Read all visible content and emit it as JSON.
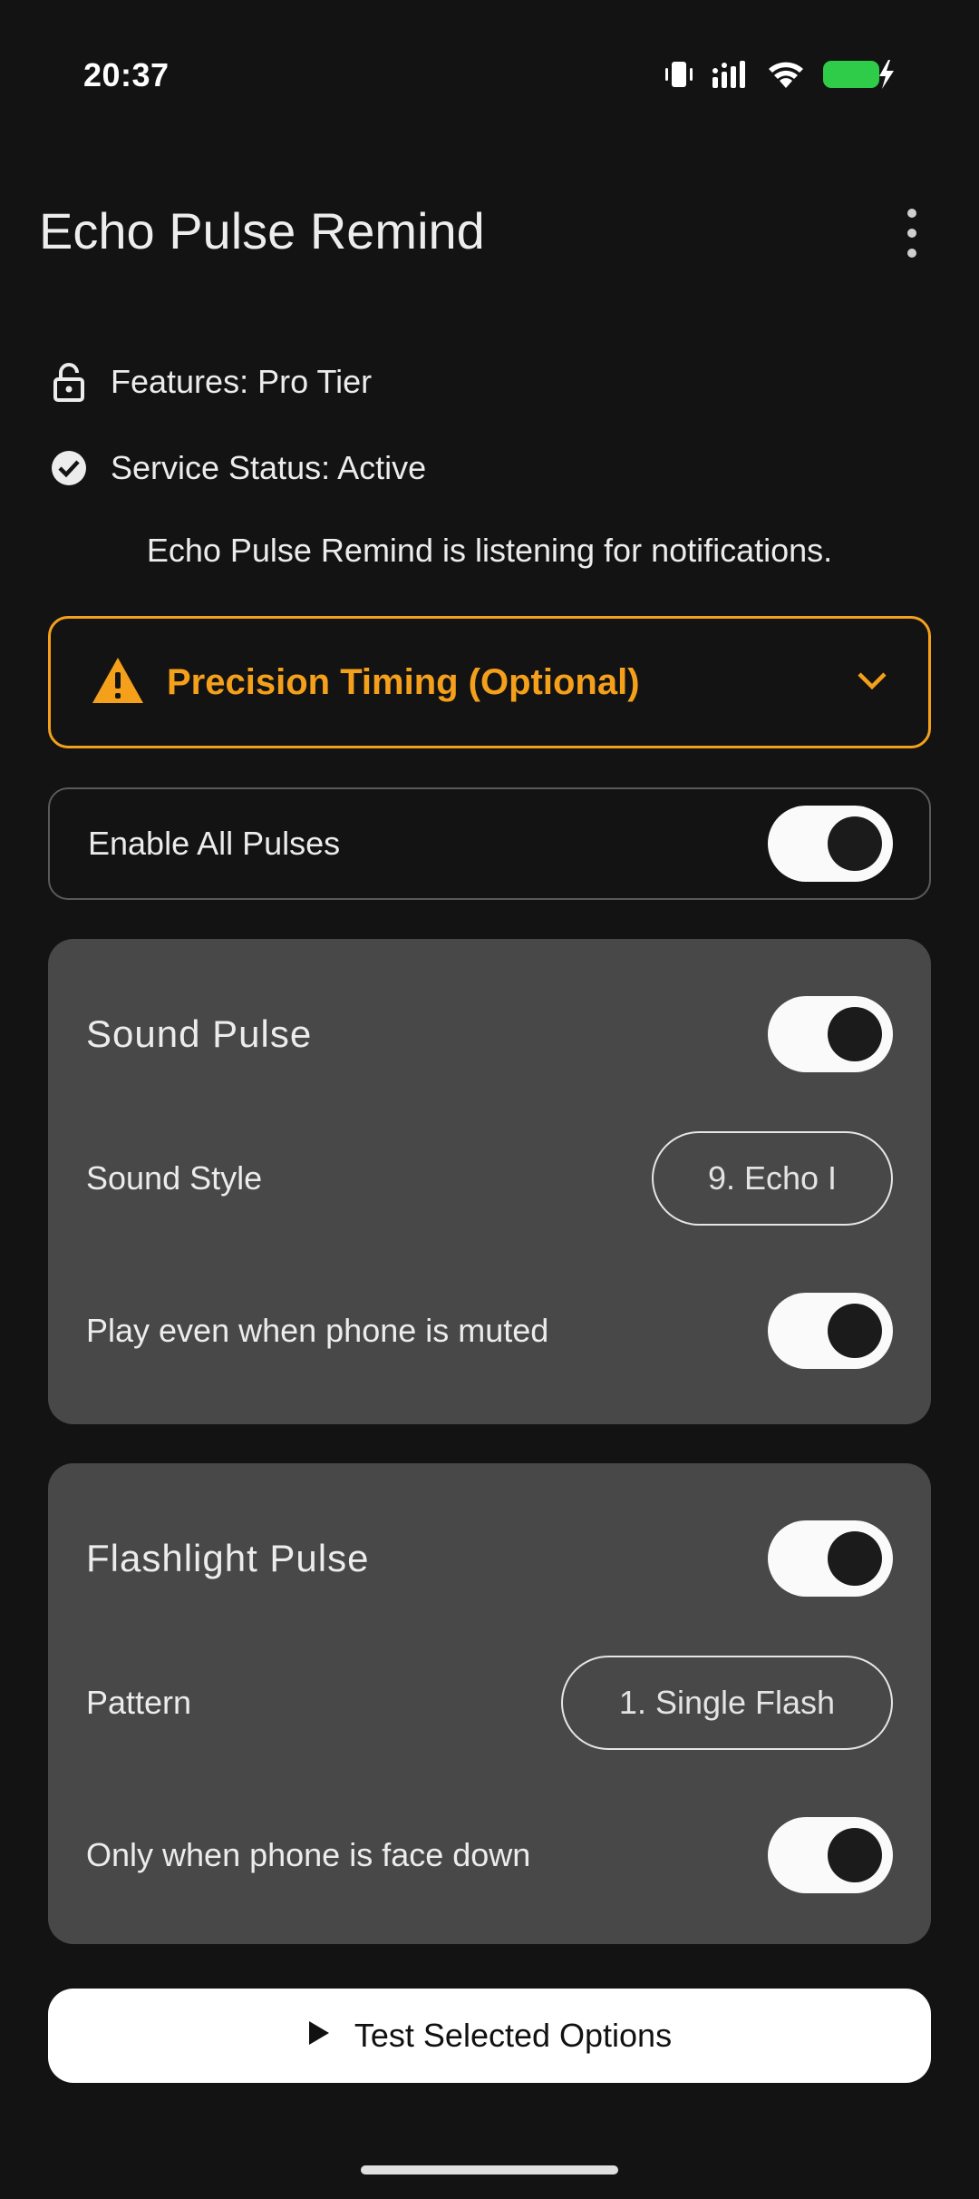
{
  "status_bar": {
    "time": "20:37",
    "icons": [
      "vibrate-icon",
      "signal-icon",
      "wifi-icon",
      "battery-charging-icon"
    ],
    "battery_color": "#2ecc48"
  },
  "app_bar": {
    "title": "Echo Pulse Remind",
    "menu_icon": "overflow-menu-icon"
  },
  "info": {
    "features": "Features: Pro Tier",
    "service_status": "Service Status: Active",
    "listening": "Echo Pulse Remind is listening for notifications."
  },
  "warning": {
    "title": "Precision Timing (Optional)",
    "accent": "#f5a01a",
    "expanded": false
  },
  "enable_all": {
    "label": "Enable All Pulses",
    "on": true
  },
  "sound_pulse": {
    "title": "Sound Pulse",
    "on": true,
    "style_label": "Sound Style",
    "style_value": "9. Echo I",
    "muted_label": "Play even when phone is muted",
    "muted_on": true
  },
  "flash_pulse": {
    "title": "Flashlight Pulse",
    "on": true,
    "pattern_label": "Pattern",
    "pattern_value": "1. Single Flash",
    "face_down_label": "Only when phone is face down",
    "face_down_on": true
  },
  "test_button": {
    "label": "Test Selected Options"
  }
}
